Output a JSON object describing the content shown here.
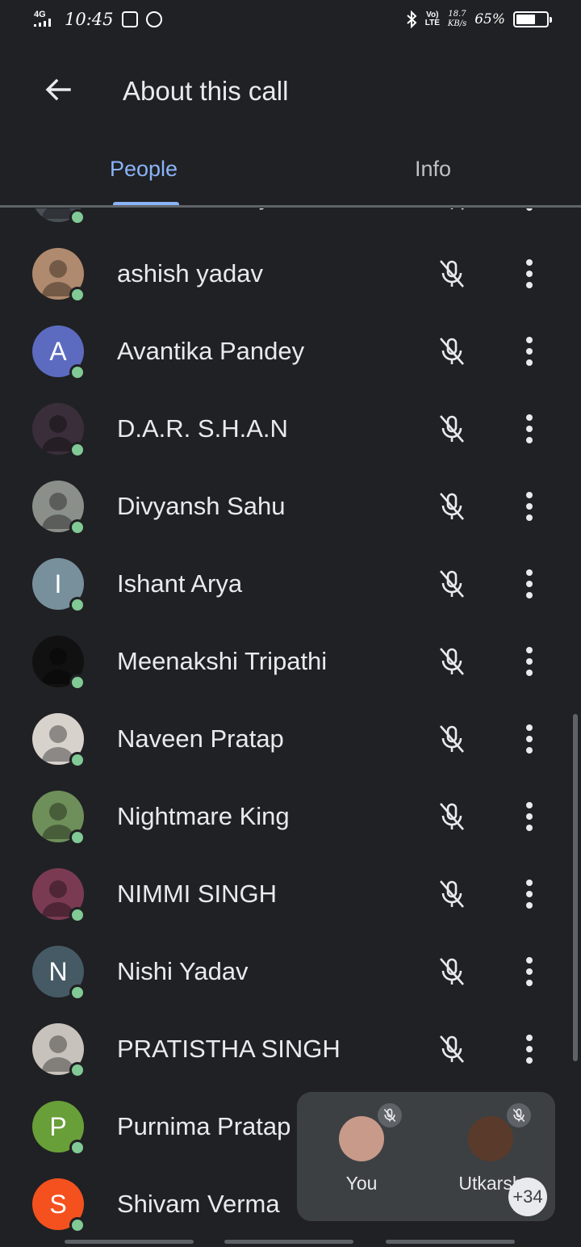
{
  "status_bar": {
    "network": "4G",
    "time": "10:45",
    "volte_line1": "Vo)",
    "volte_line2": "LTE",
    "speed_value": "18.7",
    "speed_unit": "KB/s",
    "battery_text": "65%",
    "battery_level": 0.65,
    "icons": [
      "signal-icon",
      "mail-icon",
      "app-notification-icon",
      "bluetooth-icon",
      "battery-icon"
    ]
  },
  "header": {
    "title": "About this call",
    "back_icon": "arrow-left-icon"
  },
  "tabs": [
    {
      "label": "People",
      "selected": true
    },
    {
      "label": "Info",
      "selected": false
    }
  ],
  "participants": [
    {
      "name": "Ashish Dubey",
      "avatar_type": "photo",
      "avatar_color": "#4a4f55",
      "online": true,
      "muted": true
    },
    {
      "name": "ashish yadav",
      "avatar_type": "photo",
      "avatar_color": "#b08a6e",
      "online": true,
      "muted": true
    },
    {
      "name": "Avantika Pandey",
      "avatar_type": "letter",
      "initial": "A",
      "avatar_color": "#5c6bc0",
      "online": true,
      "muted": true
    },
    {
      "name": "D.A.R. S.H.A.N",
      "avatar_type": "photo",
      "avatar_color": "#3a2e3a",
      "online": true,
      "muted": true
    },
    {
      "name": "Divyansh Sahu",
      "avatar_type": "photo",
      "avatar_color": "#8a8f8a",
      "online": true,
      "muted": true
    },
    {
      "name": "Ishant Arya",
      "avatar_type": "letter",
      "initial": "I",
      "avatar_color": "#78909c",
      "online": true,
      "muted": true
    },
    {
      "name": "Meenakshi Tripathi",
      "avatar_type": "photo",
      "avatar_color": "#111111",
      "online": true,
      "muted": true
    },
    {
      "name": "Naveen Pratap",
      "avatar_type": "photo",
      "avatar_color": "#d8d2cc",
      "online": true,
      "muted": true
    },
    {
      "name": "Nightmare King",
      "avatar_type": "photo",
      "avatar_color": "#6f8f5a",
      "online": true,
      "muted": true
    },
    {
      "name": "NIMMI SINGH",
      "avatar_type": "photo",
      "avatar_color": "#7a3b52",
      "online": true,
      "muted": true
    },
    {
      "name": "Nishi Yadav",
      "avatar_type": "letter",
      "initial": "N",
      "avatar_color": "#455a64",
      "online": true,
      "muted": true
    },
    {
      "name": "PRATISTHA SINGH",
      "avatar_type": "photo",
      "avatar_color": "#c8c2bc",
      "online": true,
      "muted": true
    },
    {
      "name": "Purnima Pratap",
      "avatar_type": "letter",
      "initial": "P",
      "avatar_color": "#689f38",
      "online": true,
      "muted": false
    },
    {
      "name": "Shivam Verma",
      "avatar_type": "letter",
      "initial": "S",
      "avatar_color": "#f4511e",
      "online": true,
      "muted": true
    }
  ],
  "pip": {
    "tiles": [
      {
        "name": "You",
        "avatar_color": "#c89a8a",
        "muted": true
      },
      {
        "name": "Utkarsh",
        "avatar_color": "#5a3a2a",
        "muted": true
      }
    ],
    "more_count": "+34"
  },
  "colors": {
    "background": "#202124",
    "accent": "#8ab4f8",
    "online": "#81c995",
    "text": "#e8eaed"
  }
}
